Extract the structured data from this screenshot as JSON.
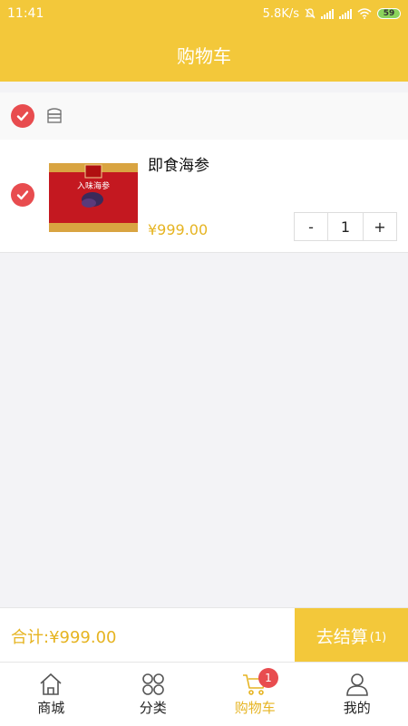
{
  "status_bar": {
    "time": "11:41",
    "speed": "5.8K/s",
    "battery": "59"
  },
  "header": {
    "title": "购物车"
  },
  "cart": {
    "items": [
      {
        "title": "即食海参",
        "price": "¥999.00",
        "quantity": "1",
        "image_text": "入味海参"
      }
    ],
    "stepper": {
      "minus": "-",
      "plus": "+"
    }
  },
  "footer": {
    "total": "合计:¥999.00",
    "checkout_label": "去结算",
    "checkout_count": "(1)"
  },
  "tabs": [
    {
      "label": "商城",
      "icon": "home-icon"
    },
    {
      "label": "分类",
      "icon": "category-icon"
    },
    {
      "label": "购物车",
      "icon": "cart-icon",
      "badge": "1",
      "active": true
    },
    {
      "label": "我的",
      "icon": "user-icon"
    }
  ],
  "colors": {
    "accent": "#f3c83a",
    "price": "#e6b422",
    "check": "#e84c4f"
  }
}
